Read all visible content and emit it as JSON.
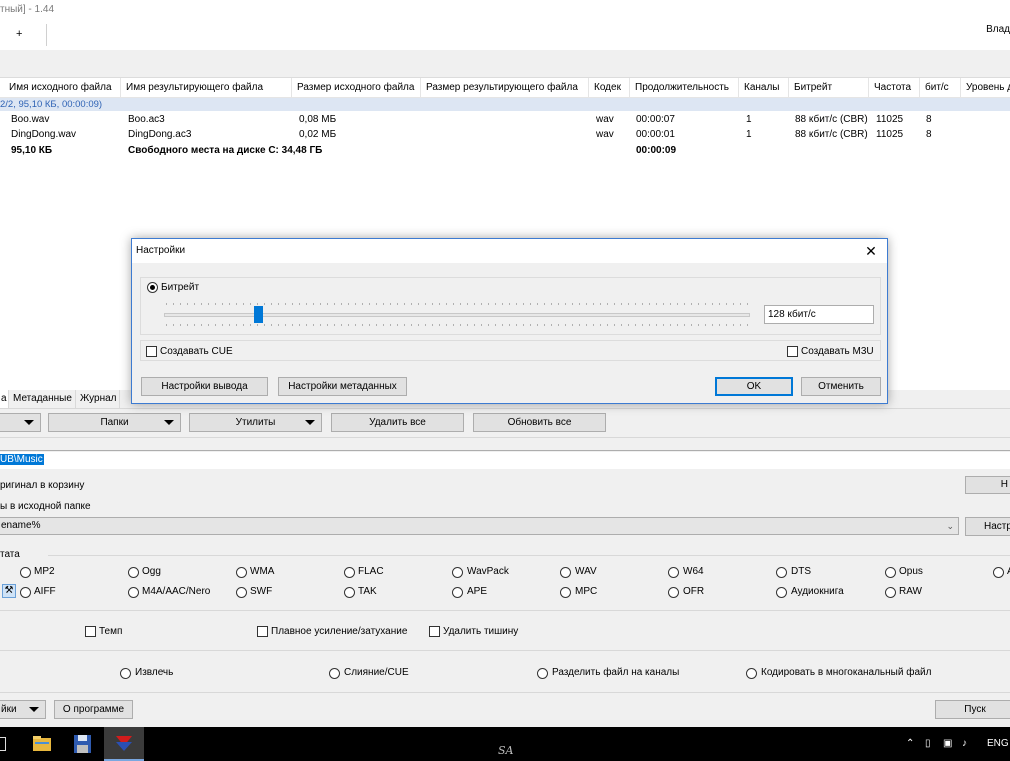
{
  "window": {
    "title": "тный] - 1.44",
    "user_label": "Влад"
  },
  "toolbar": {
    "add_label": "+"
  },
  "table": {
    "headers": [
      "Имя исходного файла",
      "Имя результирующего файла",
      "Размер исходного файла",
      "Размер результирующего файла",
      "Кодек",
      "Продолжительность",
      "Каналы",
      "Битрейт",
      "Частота",
      "бит/с",
      "Уровень д"
    ],
    "group_label": "2/2, 95,10 КБ, 00:00:09)",
    "rows": [
      [
        "Boo.wav",
        "Boo.ac3",
        "0,08 МБ",
        "wav",
        "00:00:07",
        "1",
        "88 кбит/с (CBR)",
        "11025",
        "8"
      ],
      [
        "DingDong.wav",
        "DingDong.ac3",
        "0,02 МБ",
        "wav",
        "00:00:01",
        "1",
        "88 кбит/с (CBR)",
        "11025",
        "8"
      ]
    ],
    "summary": {
      "size": "95,10 КБ",
      "free_space": "Свободного места на диске C: 34,48 ГБ",
      "duration": "00:00:09"
    }
  },
  "dialog": {
    "title": "Настройки",
    "bitrate_label": "Битрейт",
    "bitrate_value": "128 кбит/с",
    "slider_level_fraction": 0.16,
    "create_cue": "Создавать CUE",
    "create_m3u": "Создавать M3U",
    "output_settings": "Настройки вывода",
    "metadata_settings": "Настройки метаданных",
    "ok": "OK",
    "cancel": "Отменить"
  },
  "tabs": [
    "а",
    "Метаданные",
    "Журнал"
  ],
  "buttons": {
    "folders": "Папки",
    "utilities": "Утилиты",
    "delete_all": "Удалить все",
    "refresh_all": "Обновить все"
  },
  "output": {
    "path": "UB\\Music",
    "recycle": "ригинал в корзину",
    "source_folder": "ы в исходной папке",
    "pattern": "ename%",
    "right_btn_1": "Н",
    "right_btn_2": "Настр"
  },
  "format": {
    "section_label": "тата",
    "row1": [
      "MP2",
      "Ogg",
      "WMA",
      "FLAC",
      "WavPack",
      "WAV",
      "W64",
      "DTS",
      "Opus",
      "A"
    ],
    "row2": [
      "AIFF",
      "M4A/AAC/Nero",
      "SWF",
      "TAK",
      "APE",
      "MPC",
      "OFR",
      "Аудиокнига",
      "RAW"
    ]
  },
  "options": {
    "temp": "Темп",
    "fade": "Плавное усиление/затухание",
    "silence": "Удалить тишину"
  },
  "modes": [
    "Извлечь",
    "Слияние/CUE",
    "Разделить файл на каналы",
    "Кодировать в многоканальный файл"
  ],
  "bottom": {
    "settings": "йки",
    "about": "О программе",
    "start": "Пуск"
  },
  "taskbar": {
    "center_text": "SA",
    "lang": "ENG"
  },
  "colors": {
    "accent": "#0078d7",
    "group_text": "#2f63b5",
    "group_bg": "#dde6f3"
  }
}
